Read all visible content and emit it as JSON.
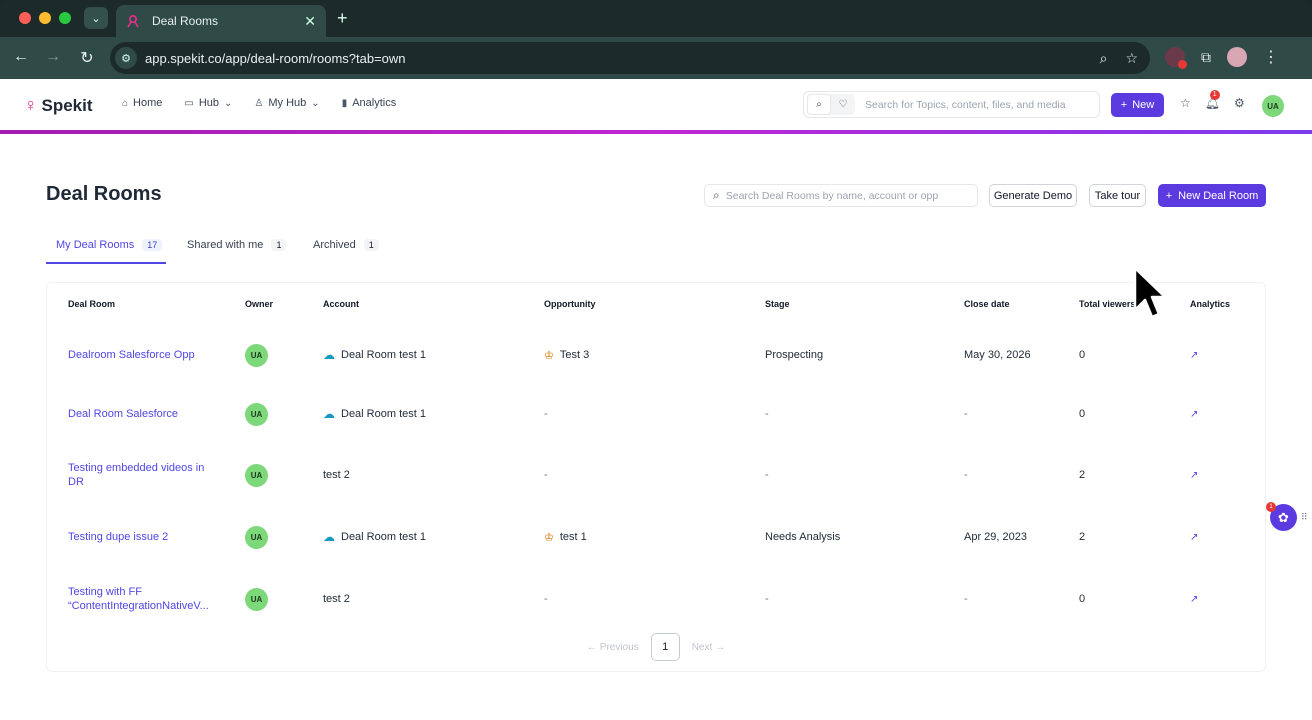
{
  "browser": {
    "tab_title": "Deal Rooms",
    "url": "app.spekit.co/app/deal-room/rooms?tab=own"
  },
  "app": {
    "logo": "Spekit",
    "nav": [
      {
        "label": "Home",
        "icon": "home-icon"
      },
      {
        "label": "Hub",
        "icon": "folder-icon",
        "dropdown": true
      },
      {
        "label": "My Hub",
        "icon": "person-icon",
        "dropdown": true
      },
      {
        "label": "Analytics",
        "icon": "bar-chart-icon"
      }
    ],
    "search_placeholder": "Search for Topics, content, files, and media",
    "new_label": "New",
    "notification_count": "1",
    "user_initials": "UA"
  },
  "page": {
    "title": "Deal Rooms",
    "search_placeholder": "Search Deal Rooms by name, account or opp",
    "generate_demo": "Generate Demo",
    "take_tour": "Take tour",
    "new_deal_room": "New Deal Room"
  },
  "tabs": [
    {
      "label": "My Deal Rooms",
      "count": "17",
      "active": true
    },
    {
      "label": "Shared with me",
      "count": "1",
      "active": false
    },
    {
      "label": "Archived",
      "count": "1",
      "active": false
    }
  ],
  "table": {
    "headers": [
      "Deal Room",
      "Owner",
      "Account",
      "Opportunity",
      "Stage",
      "Close date",
      "Total viewers",
      "Analytics"
    ],
    "rows": [
      {
        "name": "Dealroom Salesforce Opp",
        "owner": "UA",
        "account": "Deal Room test 1",
        "account_sf": true,
        "opportunity": "Test 3",
        "stage": "Prospecting",
        "close_date": "May 30, 2026",
        "viewers": "0"
      },
      {
        "name": "Deal Room Salesforce",
        "owner": "UA",
        "account": "Deal Room test 1",
        "account_sf": true,
        "opportunity": "-",
        "stage": "-",
        "close_date": "-",
        "viewers": "0"
      },
      {
        "name": "Testing embedded videos in DR",
        "owner": "UA",
        "account": "test 2",
        "account_sf": false,
        "opportunity": "-",
        "stage": "-",
        "close_date": "-",
        "viewers": "2"
      },
      {
        "name": "Testing dupe issue 2",
        "owner": "UA",
        "account": "Deal Room test 1",
        "account_sf": true,
        "opportunity": "test 1",
        "stage": "Needs Analysis",
        "close_date": "Apr 29, 2023",
        "viewers": "2"
      },
      {
        "name": "Testing with FF “ContentIntegrationNativeV...",
        "owner": "UA",
        "account": "test 2",
        "account_sf": false,
        "opportunity": "-",
        "stage": "-",
        "close_date": "-",
        "viewers": "0"
      }
    ]
  },
  "pagination": {
    "previous": "Previous",
    "current": "1",
    "next": "Next"
  },
  "widget_badge": "1",
  "colors": {
    "accent": "#5b3ae0",
    "brand_pink": "#e5308f",
    "link": "#4f46e5",
    "avatar_green": "#7dd87a"
  }
}
